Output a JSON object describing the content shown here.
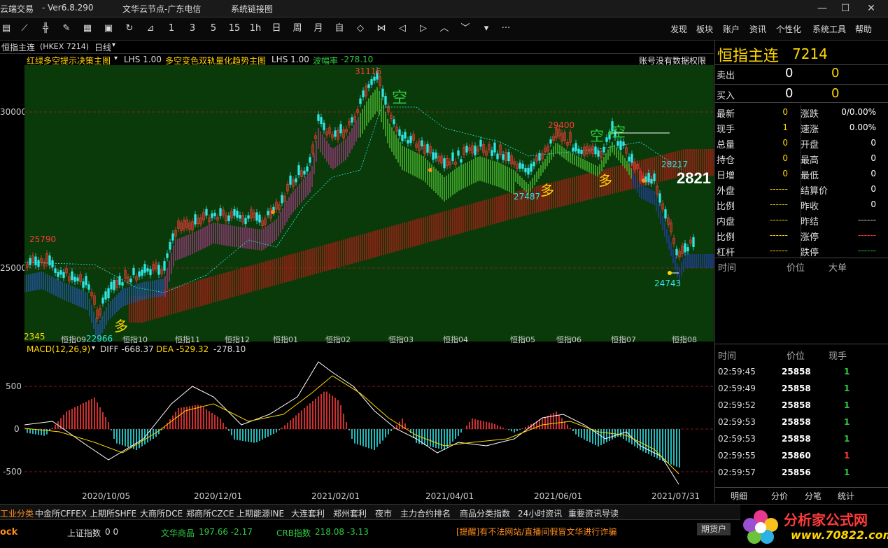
{
  "titlebar": {
    "app_name": "云端交易",
    "version": "-  Ver6.8.290",
    "server": "文华云节点-广东电信",
    "status": "系统链接图"
  },
  "toolbar": {
    "periods": [
      "1",
      "3",
      "5",
      "15",
      "1h",
      "日",
      "周",
      "月",
      "自"
    ],
    "more": "···",
    "menu": [
      "发现",
      "板块",
      "账户",
      "资讯",
      "个性化",
      "系统工具",
      "帮助"
    ]
  },
  "subbar": {
    "symbol": "恒指主连",
    "code": "(HKEX 7214)",
    "period": "日线"
  },
  "indicator_bar": {
    "name1": "红绿多空提示决策主图",
    "lhs1": "LHS 1.00",
    "name2": "多空变色双轨量化趋势主图",
    "lhs2": "LHS 1.00",
    "bodong_label": "波幅率",
    "bodong_value": "-278.10",
    "no_permission": "账号没有数据权限"
  },
  "main_chart": {
    "y_ticks": [
      "30000",
      "25000"
    ],
    "annotations": {
      "high": "31116",
      "left_high": "25790",
      "left_low1": "2345",
      "left_low2": "22966",
      "mid_high": "29400",
      "mid_low": "27487",
      "right_val": "28217",
      "right_low": "24743",
      "big_price": "2821",
      "kong1": "空",
      "kong2": "空",
      "kong3": "空",
      "duo1": "多",
      "duo2": "多",
      "duo3": "多"
    },
    "month_labels": [
      "恒指09",
      "恒指10",
      "恒指11",
      "恒指12",
      "恒指01",
      "恒指02",
      "恒指03",
      "恒指04",
      "恒指05",
      "恒指06",
      "恒指07",
      "恒指08"
    ]
  },
  "macd": {
    "label": "MACD(12,26,9)",
    "diff": "DIFF -668.37",
    "dea": "DEA -529.32",
    "macd": "-278.10",
    "y_ticks": [
      "500",
      "0",
      "-500"
    ]
  },
  "date_axis": [
    "2020/10/05",
    "2020/12/01",
    "2021/02/01",
    "2021/04/01",
    "2021/06/01",
    "2021/07/31"
  ],
  "right_panel": {
    "title": "恒指主连",
    "code": "7214",
    "sell_label": "卖出",
    "sell_price": "0",
    "sell_vol": "0",
    "buy_label": "买入",
    "buy_price": "0",
    "buy_vol": "0",
    "quote_rows": [
      {
        "l1": "最新",
        "v1": "0",
        "l2": "涨跌",
        "v2": "0/0.00%"
      },
      {
        "l1": "现手",
        "v1": "1",
        "l2": "速涨",
        "v2": "0.00%"
      },
      {
        "l1": "总量",
        "v1": "0",
        "l2": "开盘",
        "v2": "0"
      },
      {
        "l1": "持仓",
        "v1": "0",
        "l2": "最高",
        "v2": "0"
      },
      {
        "l1": "日增",
        "v1": "0",
        "l2": "最低",
        "v2": "0"
      },
      {
        "l1": "外盘",
        "v1": "------",
        "l2": "结算价",
        "v2": "0"
      },
      {
        "l1": "比例",
        "v1": "------",
        "l2": "昨收",
        "v2": "0"
      },
      {
        "l1": "内盘",
        "v1": "------",
        "l2": "昨结",
        "v2": "------"
      },
      {
        "l1": "比例",
        "v1": "------",
        "l2": "涨停",
        "v2": "------"
      },
      {
        "l1": "杠杆",
        "v1": "------",
        "l2": "跌停",
        "v2": "------"
      }
    ],
    "big_header": [
      "时间",
      "价位",
      "大单"
    ],
    "tick_header": [
      "时间",
      "价位",
      "现手"
    ],
    "ticks": [
      {
        "time": "02:59:45",
        "price": "25858",
        "vol": "1",
        "color": "#2ecc40"
      },
      {
        "time": "02:59:49",
        "price": "25858",
        "vol": "1",
        "color": "#2ecc40"
      },
      {
        "time": "02:59:52",
        "price": "25858",
        "vol": "1",
        "color": "#2ecc40"
      },
      {
        "time": "02:59:53",
        "price": "25858",
        "vol": "1",
        "color": "#2ecc40"
      },
      {
        "time": "02:59:53",
        "price": "25858",
        "vol": "1",
        "color": "#2ecc40"
      },
      {
        "time": "02:59:55",
        "price": "25860",
        "vol": "1",
        "color": "#ff3b3b"
      },
      {
        "time": "02:59:57",
        "price": "25856",
        "vol": "1",
        "color": "#2ecc40"
      }
    ],
    "tabs": [
      "明细",
      "分价",
      "分笔",
      "统计"
    ]
  },
  "bottom_bar": [
    "工业分类",
    "中金所CFFEX",
    "上期所SHFE",
    "大商所DCE",
    "郑商所CZCE",
    "上期能源INE",
    "大连套利",
    "郑州套利",
    "夜市",
    "主力合约排名",
    "商品分类指数",
    "24小时资讯",
    "重要资讯导读"
  ],
  "status_bar": {
    "left": "ock",
    "sz_label": "上证指数",
    "sz_val": "0  0",
    "wh_label": "文华商品",
    "wh_val": "197.66 -2.17",
    "crb_label": "CRB指数",
    "crb_val": "218.08 -3.13",
    "notice": "[提醒]有不法网站/直播间假冒文华进行诈骗",
    "account_btn": "期货户",
    "logo_title": "分析家公式网",
    "logo_url": "www.70822.com"
  },
  "watermark": "分析家公式网www.70822.Com",
  "colors": {
    "up": "#ff3b3b",
    "down": "#2ee6e6",
    "green": "#2ecc40",
    "yellow": "#ffd700",
    "bg_green": "#0a3a0a"
  }
}
